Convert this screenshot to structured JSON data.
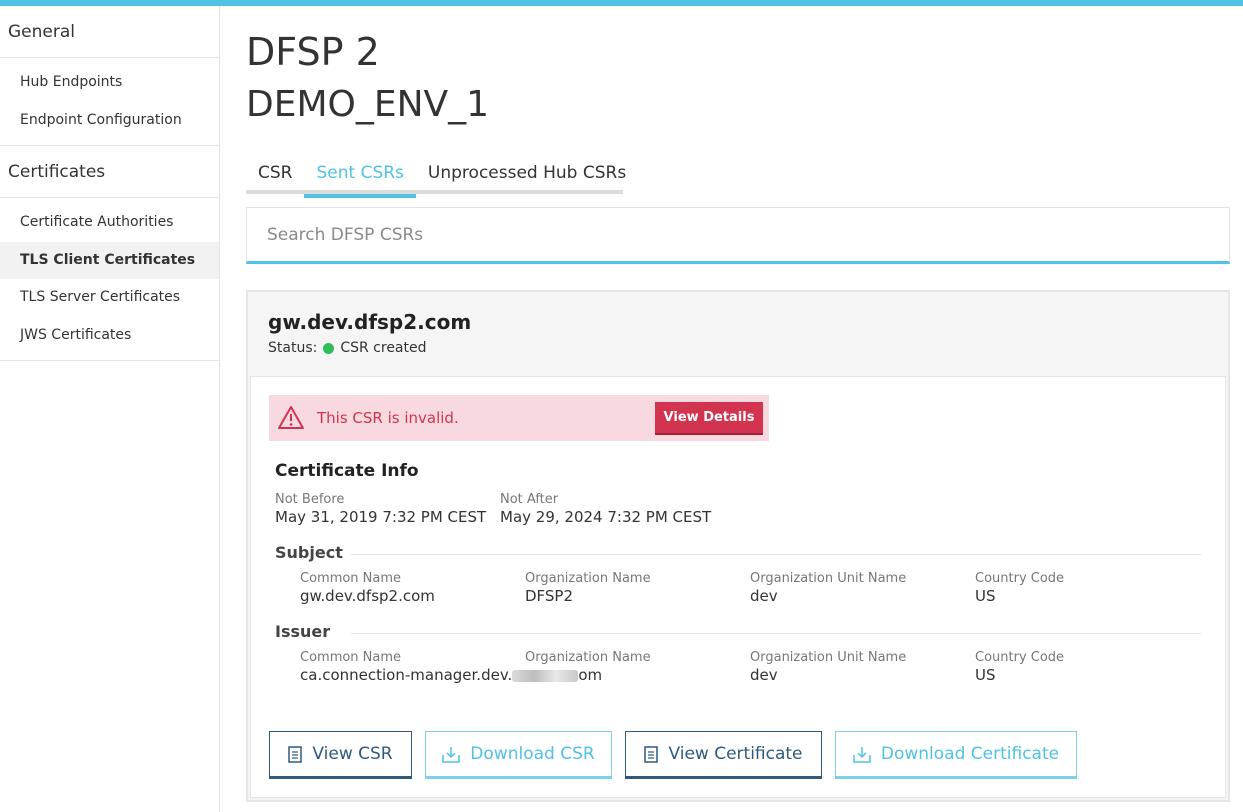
{
  "sidebar": {
    "general_label": "General",
    "general_items": [
      {
        "label": "Hub Endpoints"
      },
      {
        "label": "Endpoint Configuration"
      }
    ],
    "certificates_label": "Certificates",
    "certificate_items": [
      {
        "label": "Certificate Authorities"
      },
      {
        "label": "TLS Client Certificates",
        "active": true
      },
      {
        "label": "TLS Server Certificates"
      },
      {
        "label": "JWS Certificates"
      }
    ]
  },
  "header": {
    "title": "DFSP 2",
    "environment": "DEMO_ENV_1"
  },
  "tabs": [
    {
      "label": "CSR"
    },
    {
      "label": "Sent CSRs",
      "active": true
    },
    {
      "label": "Unprocessed Hub CSRs"
    }
  ],
  "search": {
    "placeholder": "Search DFSP CSRs",
    "value": ""
  },
  "card": {
    "title": "gw.dev.dfsp2.com",
    "status_label": "Status:",
    "status_value": "CSR created",
    "status_color": "#2dbe5b",
    "alert": {
      "message": "This CSR is invalid.",
      "button_label": "View Details",
      "icon": "warning-icon"
    },
    "certificate_info_title": "Certificate Info",
    "not_before_label": "Not Before",
    "not_before_value": "May 31, 2019 7:32 PM CEST",
    "not_after_label": "Not After",
    "not_after_value": "May 29, 2024 7:32 PM CEST",
    "subject": {
      "title": "Subject",
      "common_name_label": "Common Name",
      "common_name": "gw.dev.dfsp2.com",
      "organization_name_label": "Organization Name",
      "organization_name": "DFSP2",
      "organization_unit_label": "Organization Unit Name",
      "organization_unit": "dev",
      "country_code_label": "Country Code",
      "country_code": "US"
    },
    "issuer": {
      "title": "Issuer",
      "common_name_label": "Common Name",
      "common_name_prefix": "ca.connection-manager.dev.",
      "common_name_suffix": "om",
      "organization_name_label": "Organization Name",
      "organization_name": "",
      "organization_unit_label": "Organization Unit Name",
      "organization_unit": "dev",
      "country_code_label": "Country Code",
      "country_code": "US"
    },
    "buttons": {
      "view_csr": "View CSR",
      "download_csr": "Download CSR",
      "view_certificate": "View Certificate",
      "download_certificate": "Download Certificate"
    }
  },
  "colors": {
    "accent": "#4fc2e6",
    "danger": "#d2344f",
    "dark_button": "#2f5a7e"
  }
}
